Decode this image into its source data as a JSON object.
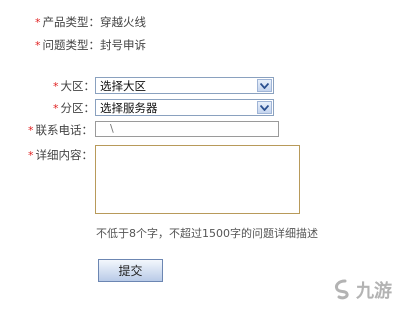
{
  "form": {
    "product_type": {
      "label": "产品类型：",
      "value": "穿越火线"
    },
    "issue_type": {
      "label": "问题类型：",
      "value": "封号申诉"
    },
    "region": {
      "label": "大区：",
      "selected": "选择大区"
    },
    "zone": {
      "label": "分区：",
      "selected": "选择服务器"
    },
    "phone": {
      "label": "联系电话：",
      "value": "\\"
    },
    "details": {
      "label": "详细内容：",
      "value": ""
    },
    "hint": "不低于8个字，不超过1500字的问题详细描述",
    "submit_label": "提交",
    "required_mark": "*"
  },
  "watermark": {
    "text": "九游"
  },
  "colors": {
    "required": "#e02020",
    "select_border": "#8aa1bf",
    "textarea_border": "#b89a5a"
  }
}
